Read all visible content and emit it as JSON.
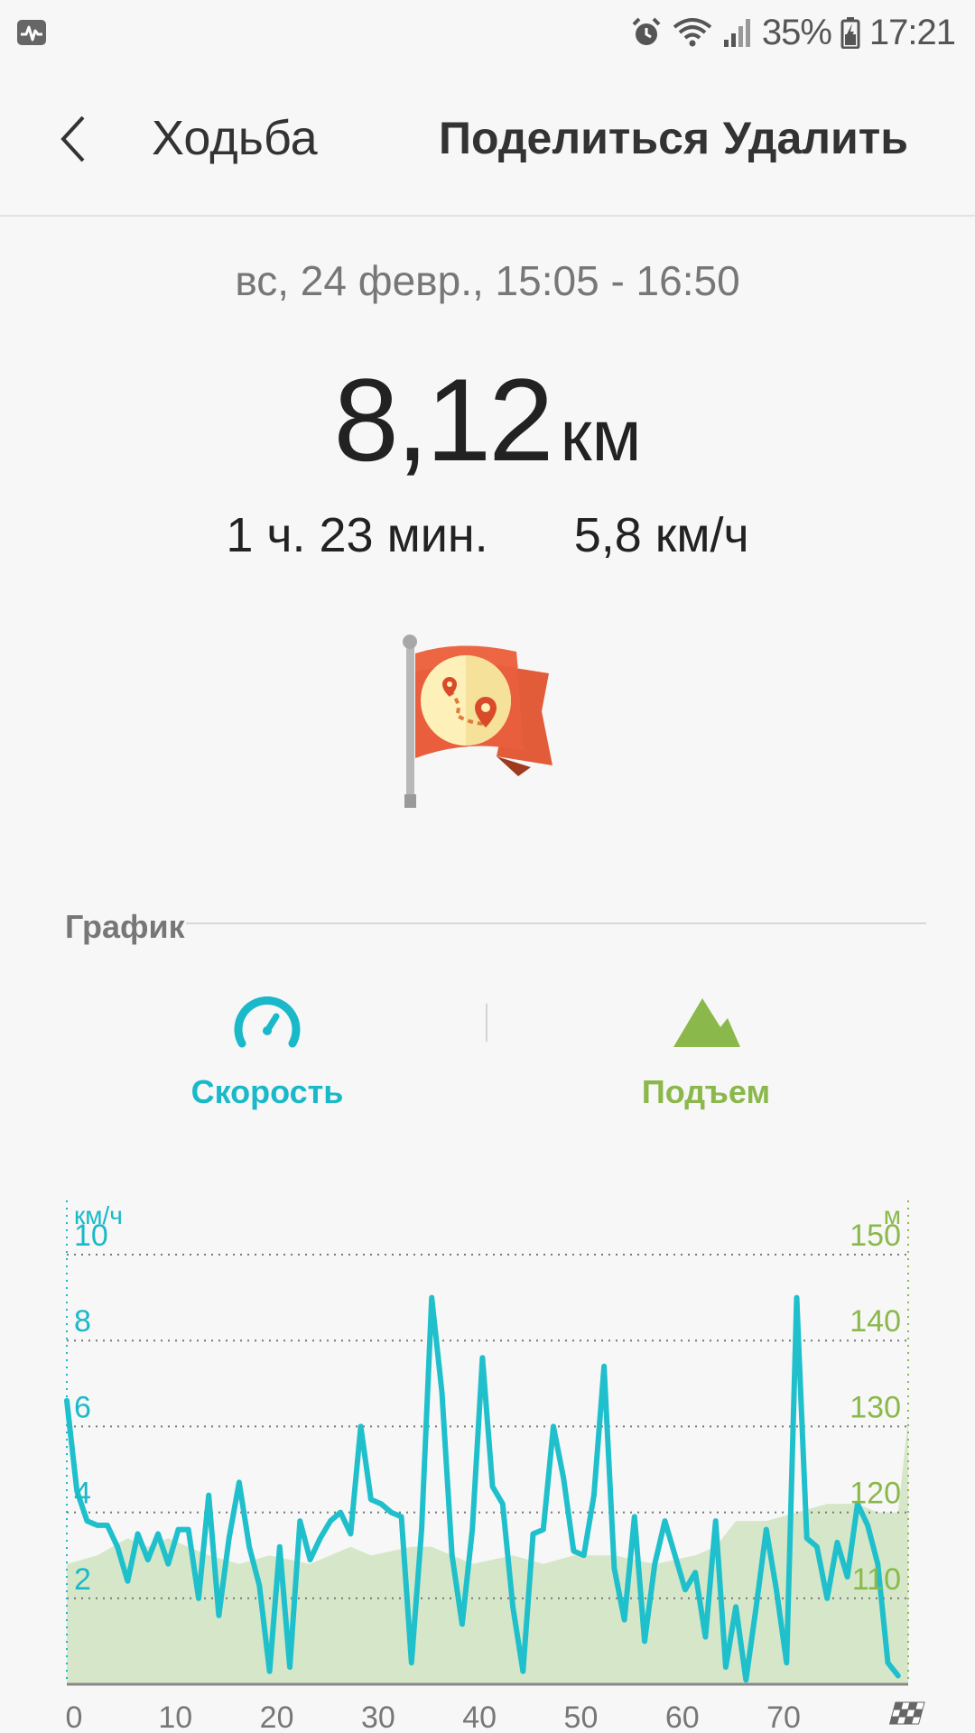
{
  "status_bar": {
    "battery": "35%",
    "time": "17:21",
    "icons": [
      "health-activity-icon",
      "alarm-icon",
      "wifi-icon",
      "signal-icon",
      "battery-charging-icon"
    ]
  },
  "app_bar": {
    "back_icon": "chevron-left-icon",
    "title": "Ходьба",
    "share_label": "Поделиться",
    "delete_label": "Удалить"
  },
  "session": {
    "date_range": "вс, 24 февр., 15:05 - 16:50",
    "distance": "8,12",
    "distance_unit": "км",
    "duration": "1 ч. 23 мин.",
    "avg_speed": "5,8 км/ч",
    "badge_icon": "route-flag-icon"
  },
  "graph_section": {
    "title": "График",
    "tabs": [
      {
        "label": "Скорость",
        "icon": "speedometer-icon",
        "color": "#19b9c9"
      },
      {
        "label": "Подъем",
        "icon": "mountain-icon",
        "color": "#8bb84a"
      }
    ]
  },
  "chart_data": {
    "type": "line",
    "x_ticks": [
      "0",
      "10",
      "20",
      "30",
      "40",
      "50",
      "60",
      "70"
    ],
    "xlim": [
      0,
      83
    ],
    "y_left": {
      "unit": "км/ч",
      "ticks": [
        "2",
        "4",
        "6",
        "8",
        "10"
      ],
      "ylim": [
        0,
        10
      ]
    },
    "y_right": {
      "unit": "м",
      "ticks": [
        "110",
        "120",
        "130",
        "140",
        "150"
      ],
      "ylim": [
        100,
        150
      ]
    },
    "grid": true,
    "series": [
      {
        "axis": "left",
        "color": "#1fc0cc",
        "points": [
          [
            0,
            6.6
          ],
          [
            1,
            4.5
          ],
          [
            2,
            3.8
          ],
          [
            3,
            3.7
          ],
          [
            4,
            3.7
          ],
          [
            5,
            3.2
          ],
          [
            6,
            2.4
          ],
          [
            7,
            3.5
          ],
          [
            8,
            2.9
          ],
          [
            9,
            3.5
          ],
          [
            10,
            2.8
          ],
          [
            11,
            3.6
          ],
          [
            12,
            3.6
          ],
          [
            13,
            2.0
          ],
          [
            14,
            4.4
          ],
          [
            15,
            1.6
          ],
          [
            16,
            3.4
          ],
          [
            17,
            4.7
          ],
          [
            18,
            3.2
          ],
          [
            19,
            2.3
          ],
          [
            20,
            0.3
          ],
          [
            21,
            3.2
          ],
          [
            22,
            0.4
          ],
          [
            23,
            3.8
          ],
          [
            24,
            2.9
          ],
          [
            25,
            3.4
          ],
          [
            26,
            3.8
          ],
          [
            27,
            4.0
          ],
          [
            28,
            3.5
          ],
          [
            29,
            6.0
          ],
          [
            30,
            4.3
          ],
          [
            31,
            4.2
          ],
          [
            32,
            4.0
          ],
          [
            33,
            3.9
          ],
          [
            34,
            0.5
          ],
          [
            35,
            3.6
          ],
          [
            36,
            9.0
          ],
          [
            37,
            6.8
          ],
          [
            38,
            3.0
          ],
          [
            39,
            1.4
          ],
          [
            40,
            3.6
          ],
          [
            41,
            7.6
          ],
          [
            42,
            4.6
          ],
          [
            43,
            4.2
          ],
          [
            44,
            1.8
          ],
          [
            45,
            0.3
          ],
          [
            46,
            3.5
          ],
          [
            47,
            3.6
          ],
          [
            48,
            6.0
          ],
          [
            49,
            4.8
          ],
          [
            50,
            3.1
          ],
          [
            51,
            3.0
          ],
          [
            52,
            4.4
          ],
          [
            53,
            7.4
          ],
          [
            54,
            2.7
          ],
          [
            55,
            1.5
          ],
          [
            56,
            3.9
          ],
          [
            57,
            1.0
          ],
          [
            58,
            2.8
          ],
          [
            59,
            3.8
          ],
          [
            60,
            3.0
          ],
          [
            61,
            2.2
          ],
          [
            62,
            2.6
          ],
          [
            63,
            1.1
          ],
          [
            64,
            3.8
          ],
          [
            65,
            0.4
          ],
          [
            66,
            1.8
          ],
          [
            67,
            0.1
          ],
          [
            68,
            1.8
          ],
          [
            69,
            3.6
          ],
          [
            70,
            2.2
          ],
          [
            71,
            0.5
          ],
          [
            72,
            9.0
          ],
          [
            73,
            3.4
          ],
          [
            74,
            3.2
          ],
          [
            75,
            2.0
          ],
          [
            76,
            3.3
          ],
          [
            77,
            2.5
          ],
          [
            78,
            4.2
          ],
          [
            79,
            3.7
          ],
          [
            80,
            2.8
          ],
          [
            81,
            0.5
          ],
          [
            82,
            0.2
          ]
        ]
      },
      {
        "axis": "right",
        "color": "#cfe4bf",
        "fill": true,
        "points": [
          [
            0,
            114
          ],
          [
            3,
            115
          ],
          [
            6,
            117
          ],
          [
            8,
            116
          ],
          [
            10,
            117
          ],
          [
            12,
            116
          ],
          [
            14,
            115
          ],
          [
            17,
            114
          ],
          [
            20,
            115
          ],
          [
            24,
            114
          ],
          [
            28,
            116
          ],
          [
            30,
            115
          ],
          [
            34,
            116
          ],
          [
            36,
            116
          ],
          [
            40,
            114
          ],
          [
            44,
            115
          ],
          [
            47,
            114
          ],
          [
            50,
            115
          ],
          [
            54,
            115
          ],
          [
            58,
            114
          ],
          [
            62,
            115
          ],
          [
            64,
            116
          ],
          [
            66,
            119
          ],
          [
            69,
            119
          ],
          [
            72,
            120
          ],
          [
            75,
            121
          ],
          [
            78,
            121
          ],
          [
            80,
            120
          ],
          [
            82,
            120
          ],
          [
            83,
            131
          ]
        ]
      }
    ]
  }
}
